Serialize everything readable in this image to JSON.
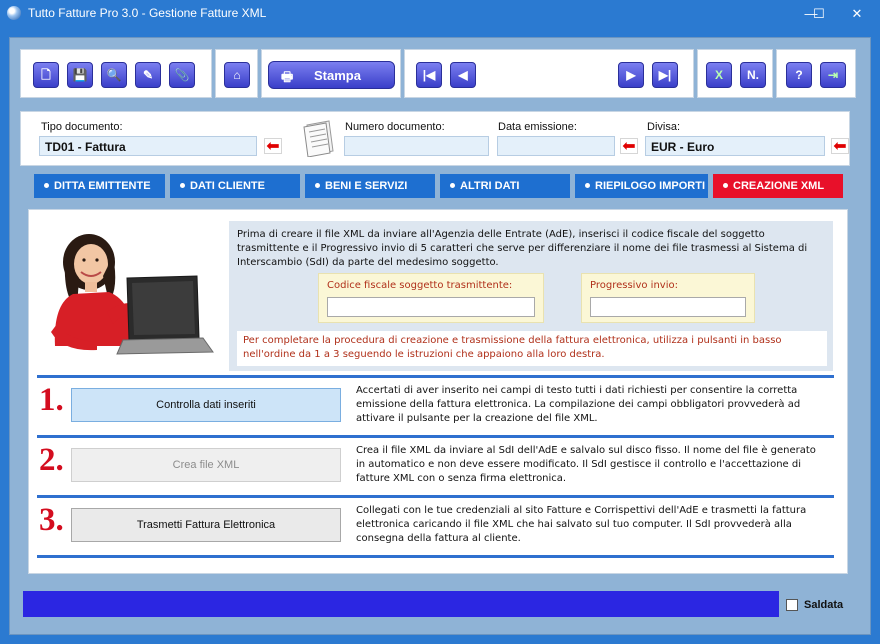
{
  "window": {
    "title": "Tutto Fatture Pro 3.0 - Gestione Fatture XML",
    "minimize": "—",
    "maximize": "☐",
    "close": "✕"
  },
  "toolbar": {
    "buttons": [
      {
        "icon": "new-document-icon",
        "glyph": "🗋"
      },
      {
        "icon": "save-icon",
        "glyph": "💾"
      },
      {
        "icon": "search-icon",
        "glyph": "🔍"
      },
      {
        "icon": "pen-icon",
        "glyph": "✎"
      },
      {
        "icon": "attach-icon",
        "glyph": "📎"
      },
      {
        "icon": "home-icon",
        "glyph": "⌂"
      },
      {
        "icon": "first-record-icon",
        "glyph": "|◀"
      },
      {
        "icon": "previous-record-icon",
        "glyph": "◀"
      },
      {
        "icon": "next-record-icon",
        "glyph": "▶"
      },
      {
        "icon": "last-record-icon",
        "glyph": "▶|"
      },
      {
        "icon": "excel-icon",
        "glyph": "X"
      },
      {
        "icon": "numbering-icon",
        "glyph": "N."
      },
      {
        "icon": "help-icon",
        "glyph": "?"
      },
      {
        "icon": "exit-icon",
        "glyph": "⇥"
      }
    ],
    "print_label": "Stampa",
    "print_glyph": "🖶"
  },
  "fields": {
    "tipo_label": "Tipo documento:",
    "tipo_value": "TD01 - Fattura",
    "numero_label": "Numero documento:",
    "numero_value": "",
    "data_label": "Data emissione:",
    "data_value": "",
    "divisa_label": "Divisa:",
    "divisa_value": "EUR - Euro",
    "arrow": "⬅"
  },
  "tabs": [
    {
      "label": "DITTA EMITTENTE"
    },
    {
      "label": "DATI CLIENTE"
    },
    {
      "label": "BENI E SERVIZI"
    },
    {
      "label": "ALTRI DATI"
    },
    {
      "label": "RIEPILOGO IMPORTI"
    },
    {
      "label": "CREAZIONE XML"
    }
  ],
  "main": {
    "intro": "Prima di creare il file XML da inviare all'Agenzia delle Entrate (AdE), inserisci il codice fiscale del soggetto trasmittente e il Progressivo invio di 5 caratteri che serve per differenziare il nome dei file trasmessi al Sistema di Interscambio (SdI) da parte del medesimo soggetto.",
    "codice_label": "Codice fiscale soggetto trasmittente:",
    "codice_value": "",
    "progressivo_label": "Progressivo invio:",
    "progressivo_value": "",
    "note": "Per completare la procedura di creazione e trasmissione della fattura elettronica, utilizza i pulsanti in basso nell'ordine da 1 a 3 seguendo le istruzioni che appaiono alla loro destra.",
    "steps": [
      {
        "number": "1.",
        "button": "Controlla dati inseriti",
        "text": "Accertati di aver inserito nei campi di testo tutti i dati richiesti per consentire la corretta emissione della fattura elettronica. La compilazione dei campi obbligatori provvederà ad attivare il pulsante per la creazione del file XML."
      },
      {
        "number": "2.",
        "button": "Crea file XML",
        "text": "Crea il file XML da inviare al SdI dell'AdE e salvalo sul disco fisso. Il nome del file è generato in automatico e non deve essere modificato. Il SdI gestisce il controllo e l'accettazione di fatture XML con o senza firma elettronica."
      },
      {
        "number": "3.",
        "button": "Trasmetti Fattura Elettronica",
        "text": "Collegati con le tue credenziali al sito Fatture e Corrispettivi dell'AdE e trasmetti la fattura elettronica caricando il file XML che hai salvato sul tuo computer. Il SdI provvederà alla consegna della fattura al cliente."
      }
    ]
  },
  "footer": {
    "saldata_label": "Saldata",
    "saldata_checked": false
  },
  "colors": {
    "title_bar": "#2b7ad1",
    "tab": "#1e6fd0",
    "tab_active": "#e8102a",
    "step_number": "#d40d1f",
    "bottom_bar": "#2b26e2"
  }
}
